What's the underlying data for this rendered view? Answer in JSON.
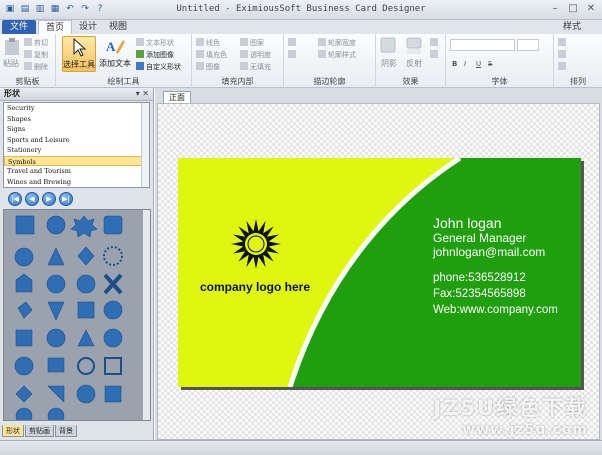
{
  "window": {
    "title": "Untitled - EximiousSoft Business Card Designer"
  },
  "tabs": {
    "file": "文件",
    "home": "首页",
    "design": "设计",
    "view": "视图",
    "style": "样式"
  },
  "ribbon": {
    "clipboard": {
      "paste": "粘贴",
      "cut": "剪切",
      "copy": "复制",
      "delete": "删除",
      "label": "剪贴板"
    },
    "drawing": {
      "select_tool": "选择工具",
      "add_text": "添加文本",
      "text_shape": "文本形状",
      "add_image": "添加图像",
      "custom_shape": "自定义形状",
      "label": "绘制工具"
    },
    "fill": {
      "line_color": "线色",
      "fill_color": "填充色",
      "pattern": "图案",
      "image": "图像",
      "transparency": "透明度",
      "no_fill": "无填充",
      "label": "填充内部"
    },
    "outline": {
      "outline_width": "轮廓宽度",
      "outline_style": "轮廓样式",
      "label": "描边轮廓"
    },
    "effects": {
      "shadow": "阴影",
      "reflection": "反射",
      "label": "效果"
    },
    "font": {
      "bold": "B",
      "italic": "I",
      "underline": "U",
      "strike": "S",
      "label": "字体"
    },
    "arrange": {
      "label": "排列"
    }
  },
  "left_panel": {
    "title": "形状",
    "categories": [
      "Security",
      "Shapes",
      "Signs",
      "Sports and Leisure",
      "Stationery",
      "Symbols",
      "Travel and Tourism",
      "Wines and Brewing"
    ],
    "selected": "Symbols",
    "bottom_tabs": [
      "形状",
      "剪贴画",
      "背景"
    ]
  },
  "document": {
    "tab": "正面"
  },
  "card": {
    "logo_text": "company logo here",
    "name": "John logan",
    "title": "General Manager",
    "email": "johnlogan@mail.com",
    "phone": "phone:536528912",
    "fax": "Fax:52354565898",
    "web": "Web:www.company.com",
    "colors": {
      "yellow": "#dff70f",
      "green": "#1f9f0d",
      "white_stripe": "#ffffff"
    }
  },
  "watermark": {
    "line1": "JZ5U绿色下载",
    "line2": "www.jz5u.com"
  }
}
